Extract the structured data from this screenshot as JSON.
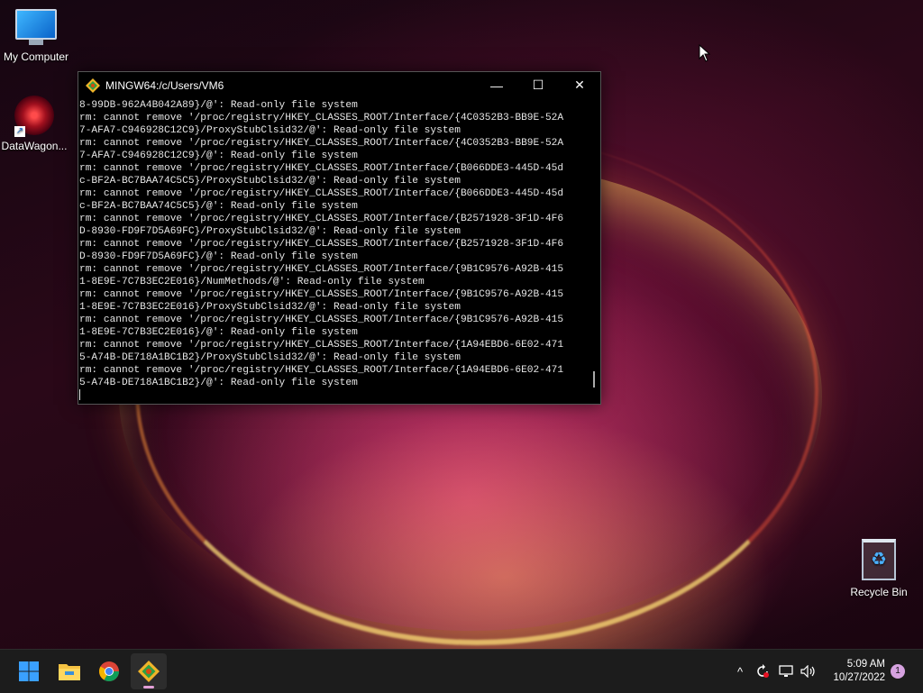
{
  "desktop": {
    "icons": [
      {
        "label": "My Computer",
        "icon": "computer-icon"
      },
      {
        "label": "DataWagon...",
        "icon": "datawagon-icon"
      },
      {
        "label": "Recycle Bin",
        "icon": "recycle-bin-icon"
      }
    ]
  },
  "window": {
    "title": "MINGW64:/c/Users/VM6",
    "controls": {
      "minimize": "—",
      "maximize": "☐",
      "close": "✕"
    },
    "lines": [
      "8-99DB-962A4B042A89}/@': Read-only file system",
      "rm: cannot remove '/proc/registry/HKEY_CLASSES_ROOT/Interface/{4C0352B3-BB9E-52A",
      "7-AFA7-C946928C12C9}/ProxyStubClsid32/@': Read-only file system",
      "rm: cannot remove '/proc/registry/HKEY_CLASSES_ROOT/Interface/{4C0352B3-BB9E-52A",
      "7-AFA7-C946928C12C9}/@': Read-only file system",
      "rm: cannot remove '/proc/registry/HKEY_CLASSES_ROOT/Interface/{B066DDE3-445D-45d",
      "c-BF2A-BC7BAA74C5C5}/ProxyStubClsid32/@': Read-only file system",
      "rm: cannot remove '/proc/registry/HKEY_CLASSES_ROOT/Interface/{B066DDE3-445D-45d",
      "c-BF2A-BC7BAA74C5C5}/@': Read-only file system",
      "rm: cannot remove '/proc/registry/HKEY_CLASSES_ROOT/Interface/{B2571928-3F1D-4F6",
      "D-8930-FD9F7D5A69FC}/ProxyStubClsid32/@': Read-only file system",
      "rm: cannot remove '/proc/registry/HKEY_CLASSES_ROOT/Interface/{B2571928-3F1D-4F6",
      "D-8930-FD9F7D5A69FC}/@': Read-only file system",
      "rm: cannot remove '/proc/registry/HKEY_CLASSES_ROOT/Interface/{9B1C9576-A92B-415",
      "1-8E9E-7C7B3EC2E016}/NumMethods/@': Read-only file system",
      "rm: cannot remove '/proc/registry/HKEY_CLASSES_ROOT/Interface/{9B1C9576-A92B-415",
      "1-8E9E-7C7B3EC2E016}/ProxyStubClsid32/@': Read-only file system",
      "rm: cannot remove '/proc/registry/HKEY_CLASSES_ROOT/Interface/{9B1C9576-A92B-415",
      "1-8E9E-7C7B3EC2E016}/@': Read-only file system",
      "rm: cannot remove '/proc/registry/HKEY_CLASSES_ROOT/Interface/{1A94EBD6-6E02-471",
      "5-A74B-DE718A1BC1B2}/ProxyStubClsid32/@': Read-only file system",
      "rm: cannot remove '/proc/registry/HKEY_CLASSES_ROOT/Interface/{1A94EBD6-6E02-471",
      "5-A74B-DE718A1BC1B2}/@': Read-only file system"
    ]
  },
  "taskbar": {
    "apps": [
      {
        "name": "start-button",
        "icon": "windows-logo-icon"
      },
      {
        "name": "file-explorer-button",
        "icon": "folder-icon"
      },
      {
        "name": "chrome-button",
        "icon": "chrome-icon"
      },
      {
        "name": "git-bash-button",
        "icon": "git-icon",
        "active": true
      }
    ],
    "tray": {
      "chevron": "^",
      "time": "5:09 AM",
      "date": "10/27/2022",
      "notifications": "1"
    }
  }
}
